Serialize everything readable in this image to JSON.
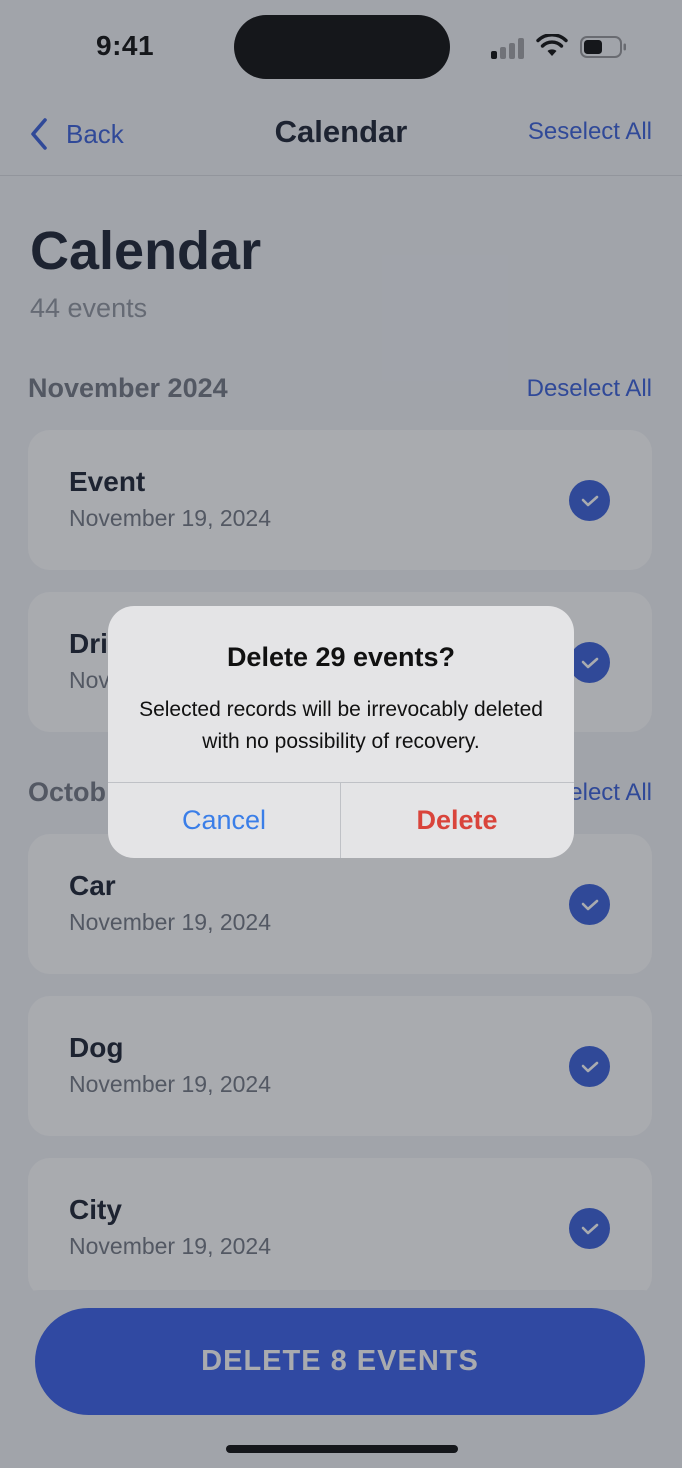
{
  "status_bar": {
    "time": "9:41"
  },
  "nav": {
    "back_label": "Back",
    "title": "Calendar",
    "right_action": "Seselect All"
  },
  "header": {
    "title": "Calendar",
    "subtitle": "44 events"
  },
  "sections": [
    {
      "title": "November 2024",
      "action": "Deselect All",
      "items": [
        {
          "title": "Event",
          "date": "November 19, 2024",
          "selected": true
        },
        {
          "title": "Dri",
          "date": "Nov",
          "selected": true
        }
      ]
    },
    {
      "title": "Octob",
      "action": "elect All",
      "items": [
        {
          "title": "Car",
          "date": "November 19, 2024",
          "selected": true
        },
        {
          "title": "Dog",
          "date": "November 19, 2024",
          "selected": true
        },
        {
          "title": "City",
          "date": "November 19, 2024",
          "selected": true
        }
      ]
    }
  ],
  "bottom": {
    "delete_button": "DELETE  8 EVENTS"
  },
  "alert": {
    "title": "Delete 29 events?",
    "message": "Selected records will be irrevocably deleted with no possibility of recovery.",
    "cancel": "Cancel",
    "confirm": "Delete"
  },
  "colors": {
    "accent": "#2f57d8",
    "destructive": "#d9443b",
    "alert_cancel": "#3a7ee8"
  }
}
